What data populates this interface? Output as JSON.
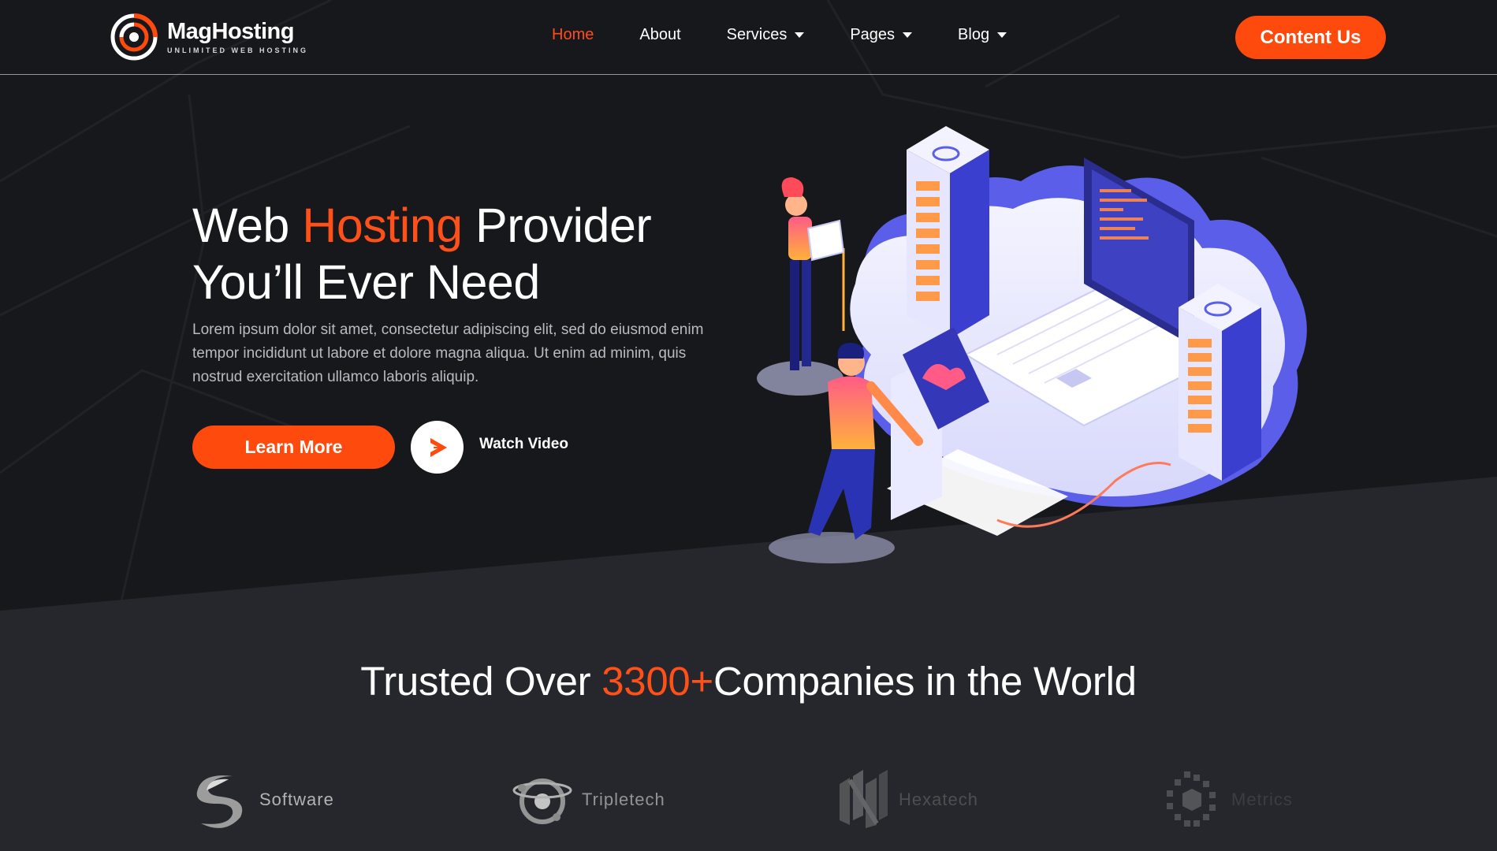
{
  "brand": {
    "name": "MagHosting",
    "tagline": "UNLIMITED WEB HOSTING",
    "accent_color": "#ff4a0e"
  },
  "nav": {
    "items": [
      {
        "label": "Home",
        "active": true,
        "dropdown": false
      },
      {
        "label": "About",
        "active": false,
        "dropdown": false
      },
      {
        "label": "Services",
        "active": false,
        "dropdown": true
      },
      {
        "label": "Pages",
        "active": false,
        "dropdown": true
      },
      {
        "label": "Blog",
        "active": false,
        "dropdown": true
      }
    ],
    "cta_label": "Content Us"
  },
  "hero": {
    "title_part1": "Web ",
    "title_accent": "Hosting",
    "title_part2": " Provider",
    "title_line2": "You’ll Ever Need",
    "description": "Lorem ipsum dolor sit amet, consectetur adipiscing elit, sed do eiusmod enim tempor incididunt ut labore et dolore magna aliqua. Ut enim ad minim, quis nostrud exercitation ullamco laboris aliquip.",
    "primary_button": "Learn More",
    "video_label": "Watch Video",
    "play_icon": "play-icon"
  },
  "trusted": {
    "prefix": "Trusted Over ",
    "count": "3300+",
    "suffix": "Companies in the World"
  },
  "clients": [
    {
      "name": "Software",
      "icon": "software-logo-icon"
    },
    {
      "name": "Tripletech",
      "icon": "tripletech-logo-icon"
    },
    {
      "name": "Hexatech",
      "icon": "hexatech-logo-icon"
    },
    {
      "name": "Metrics",
      "icon": "metrics-logo-icon"
    }
  ]
}
